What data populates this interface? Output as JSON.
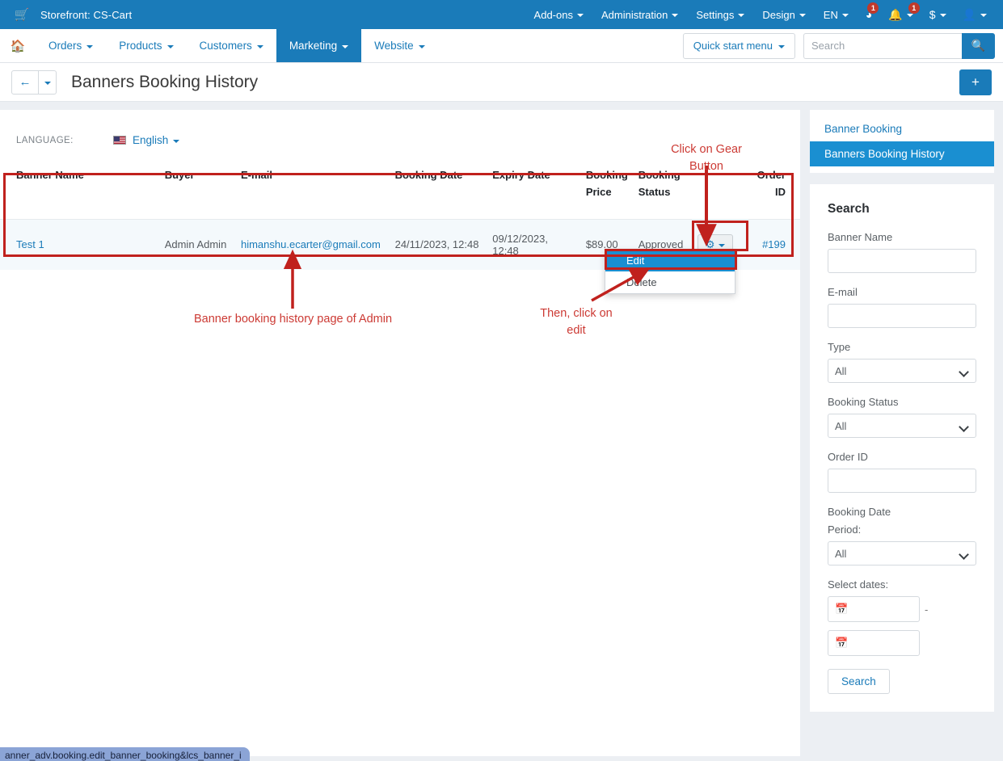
{
  "topbar": {
    "cart_icon": "cart-icon",
    "storefront": "Storefront: CS-Cart",
    "menu": [
      {
        "label": "Add-ons"
      },
      {
        "label": "Administration"
      },
      {
        "label": "Settings"
      },
      {
        "label": "Design"
      },
      {
        "label": "EN"
      }
    ],
    "icons": [
      {
        "name": "notifications-icon",
        "glyph": "◕",
        "badge": "1"
      },
      {
        "name": "alerts-bell-icon",
        "glyph": "🔔",
        "badge": "1"
      },
      {
        "name": "currency-icon",
        "glyph": "$",
        "badge": ""
      },
      {
        "name": "user-account-icon",
        "glyph": "👤",
        "badge": ""
      }
    ]
  },
  "navbar": {
    "home_icon": "home-icon",
    "items": [
      {
        "label": "Orders",
        "active": false
      },
      {
        "label": "Products",
        "active": false
      },
      {
        "label": "Customers",
        "active": false
      },
      {
        "label": "Marketing",
        "active": true
      },
      {
        "label": "Website",
        "active": false
      }
    ],
    "quick_start_label": "Quick start menu",
    "search_placeholder": "Search",
    "search_value": "",
    "search_button_icon": "search-icon"
  },
  "titlebar": {
    "back_icon": "arrow-left-icon",
    "title": "Banners Booking History",
    "add_label": "+"
  },
  "language": {
    "label": "LANGUAGE:",
    "selected": "English",
    "flag": "us-flag-icon"
  },
  "table": {
    "columns": [
      "Banner Name",
      "Buyer",
      "E-mail",
      "Booking Date",
      "Expiry Date",
      "Booking Price",
      "Booking Status",
      "",
      "Order ID"
    ],
    "rows": [
      {
        "banner_name": "Test 1",
        "buyer": "Admin Admin",
        "email": "himanshu.ecarter@gmail.com",
        "booking_date": "24/11/2023, 12:48",
        "expiry_date": "09/12/2023, 12:48",
        "booking_price": "$89.00",
        "booking_status": "Approved",
        "gear_icon": "gear-icon",
        "order_id": "#199"
      }
    ]
  },
  "dropdown": {
    "items": [
      {
        "label": "Edit",
        "selected": true
      },
      {
        "label": "Delete",
        "selected": false
      }
    ]
  },
  "sidebar": {
    "links": [
      {
        "label": "Banner Booking",
        "active": false
      },
      {
        "label": "Banners Booking History",
        "active": true
      }
    ],
    "search": {
      "heading": "Search",
      "banner_name_label": "Banner Name",
      "banner_name_value": "",
      "email_label": "E-mail",
      "email_value": "",
      "type_label": "Type",
      "type_value": "All",
      "booking_status_label": "Booking Status",
      "booking_status_value": "All",
      "order_id_label": "Order ID",
      "order_id_value": "",
      "booking_date_label": "Booking Date",
      "period_label": "Period:",
      "period_value": "All",
      "select_dates_label": "Select dates:",
      "date_from": "",
      "date_to": "",
      "date_separator": "-",
      "calendar_icon": "calendar-icon",
      "submit_label": "Search"
    }
  },
  "annotations": {
    "gear": "Click on Gear\nButton",
    "page": "Banner booking history page of Admin",
    "edit": "Then, click on\nedit"
  },
  "status_url": "anner_adv.booking.edit_banner_booking&lcs_banner_i",
  "colors": {
    "brand_blue": "#1a7bb9",
    "active_blue": "#1a8fd1",
    "annotation_red": "#c0211d",
    "badge_red": "#c0392b",
    "row_bg": "#f4f9fc"
  }
}
